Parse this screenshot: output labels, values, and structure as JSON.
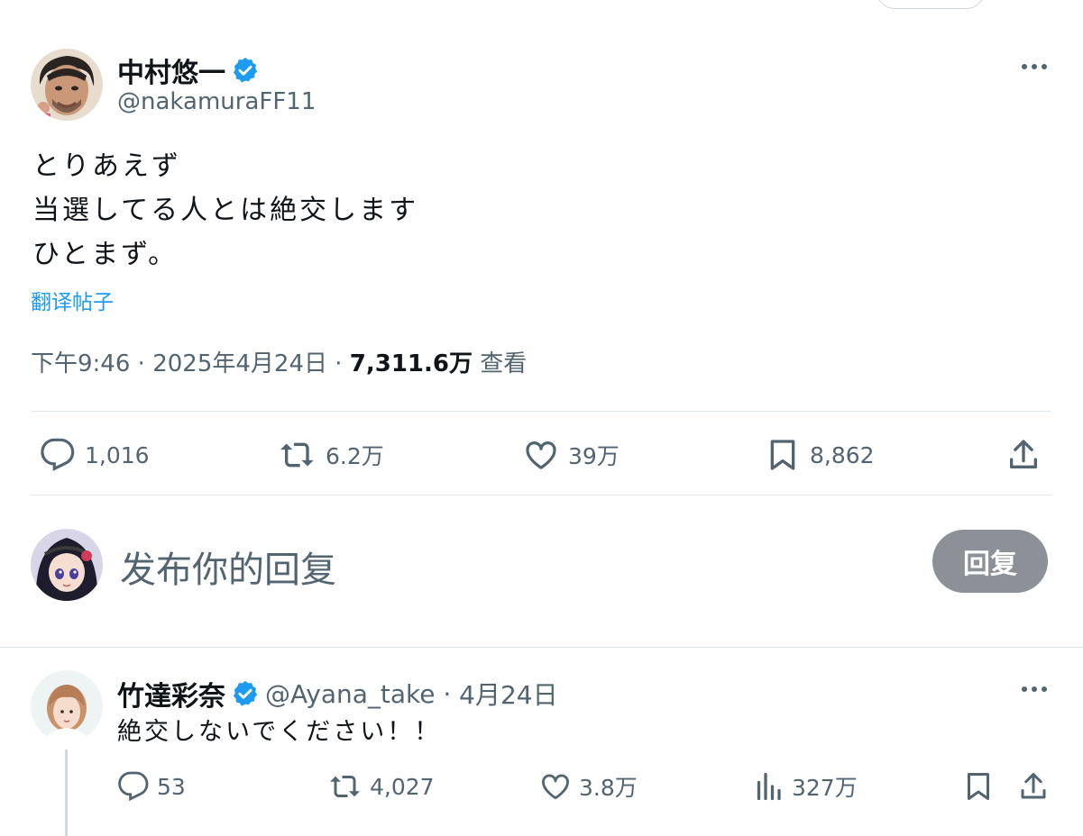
{
  "tweet": {
    "author_name": "中村悠一",
    "author_handle": "@nakamuraFF11",
    "lines": [
      "とりあえず",
      "当選してる人とは絶交します",
      "ひとまず。"
    ],
    "translate_label": "翻译帖子",
    "time": "下午9:46",
    "date": "2025年4月24日",
    "views_count": "7,311.6万",
    "views_label": "查看",
    "stats": {
      "replies": "1,016",
      "retweets": "6.2万",
      "likes": "39万",
      "bookmarks": "8,862"
    }
  },
  "compose": {
    "placeholder": "发布你的回复",
    "button_label": "回复"
  },
  "reply": {
    "author_name": "竹達彩奈",
    "author_handle": "@Ayana_take",
    "date": "4月24日",
    "text": "絶交しないでください！！",
    "stats": {
      "replies": "53",
      "retweets": "4,027",
      "likes": "3.8万",
      "views": "327万"
    }
  },
  "colors": {
    "link": "#1d9bf0",
    "verified": "#1d9bf0",
    "muted": "#536471",
    "button_disabled": "#8b9196"
  }
}
